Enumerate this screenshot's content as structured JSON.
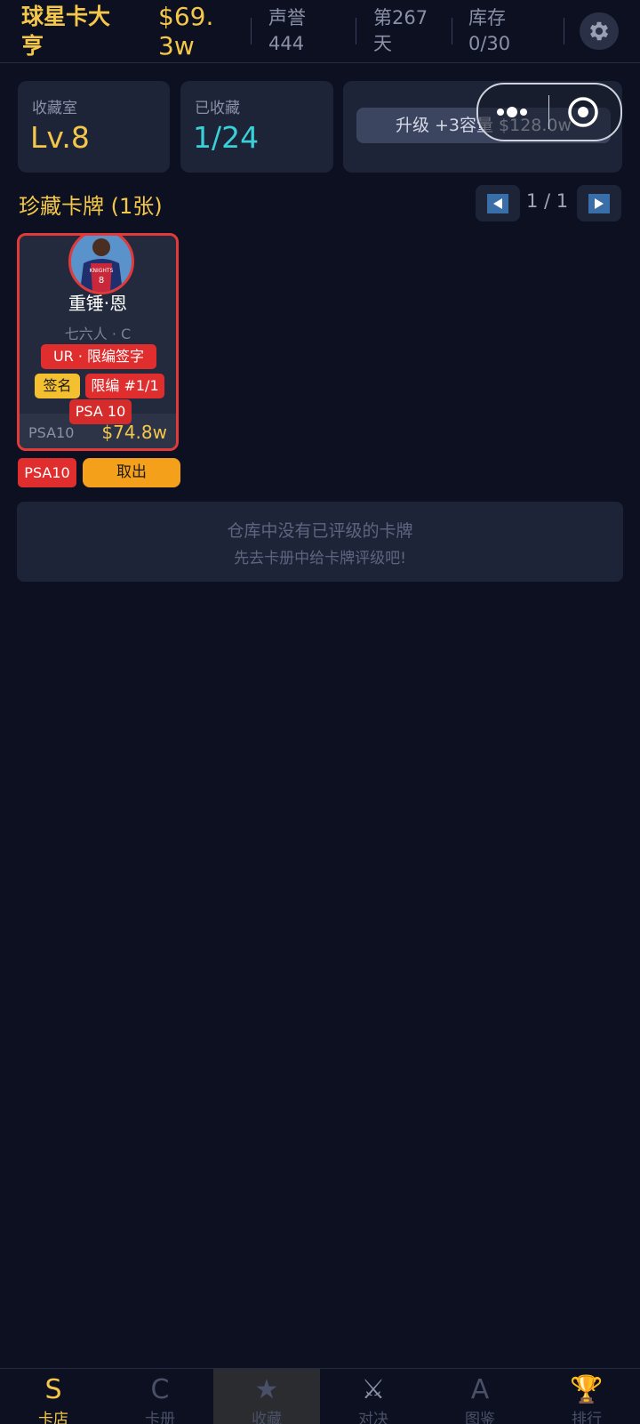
{
  "header": {
    "title": "球星卡大亨",
    "money": "$69.3w",
    "reputation_label": "声誉",
    "reputation_value": "444",
    "day_label": "第267",
    "day_suffix": "天",
    "inventory_label": "库存",
    "inventory_value": "0/30",
    "settings_icon": "gear-icon"
  },
  "stats": {
    "room_label": "收藏室",
    "room_value": "Lv.8",
    "collected_label": "已收藏",
    "collected_value": "1/24",
    "upgrade_label": "升级 +3容量 $128.0w"
  },
  "section": {
    "title": "珍藏卡牌 (1张)",
    "page": "1 / 1"
  },
  "card": {
    "name": "重锤·恩",
    "team": "七六人 · C",
    "rarity": "UR · 限编签字",
    "tag_sign": "签名",
    "tag_limited": "限编 #1/1",
    "grade_overlay": "PSA 10",
    "grade_small": "PSA10",
    "price": "$74.8w",
    "jersey_text": "KNIGHTS",
    "jersey_number": "8"
  },
  "card_actions": {
    "grade_badge": "PSA10",
    "take_out": "取出"
  },
  "empty_state": {
    "line1": "仓库中没有已评级的卡牌",
    "line2": "先去卡册中给卡牌评级吧!"
  },
  "nav": {
    "items": [
      {
        "icon": "S",
        "label": "卡店"
      },
      {
        "icon": "C",
        "label": "卡册"
      },
      {
        "icon": "★",
        "label": "收藏"
      },
      {
        "icon": "⚔",
        "label": "对决"
      },
      {
        "icon": "A",
        "label": "图鉴"
      },
      {
        "icon": "🏆",
        "label": "排行"
      }
    ],
    "active_index": 2
  },
  "colors": {
    "background": "#0c1020",
    "panel": "#1e2438",
    "gold": "#f4c74a",
    "cyan": "#3ad0d8",
    "red": "#e02d2d",
    "orange": "#f5a01b"
  }
}
